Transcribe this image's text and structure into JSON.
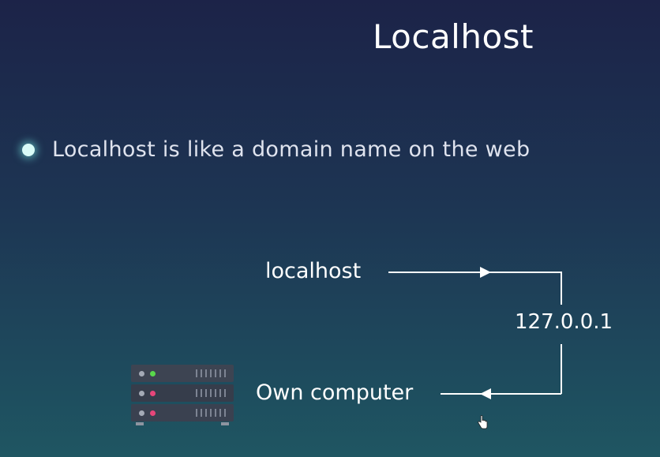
{
  "slide": {
    "title": "Localhost",
    "bullet": "Localhost is like a domain name on the web",
    "diagram": {
      "localhost_label": "localhost",
      "ip_label": "127.0.0.1",
      "own_computer_label": "Own computer"
    }
  },
  "colors": {
    "background_top": "#1c2348",
    "background_bottom": "#1f5662",
    "bullet_glow": "#d9fbf7",
    "led_green": "#59d84b",
    "led_red": "#e8467a"
  },
  "icons": [
    "bullet-dot-icon",
    "server-rack-icon",
    "arrow-right-icon",
    "arrow-left-icon",
    "hand-cursor-icon"
  ]
}
